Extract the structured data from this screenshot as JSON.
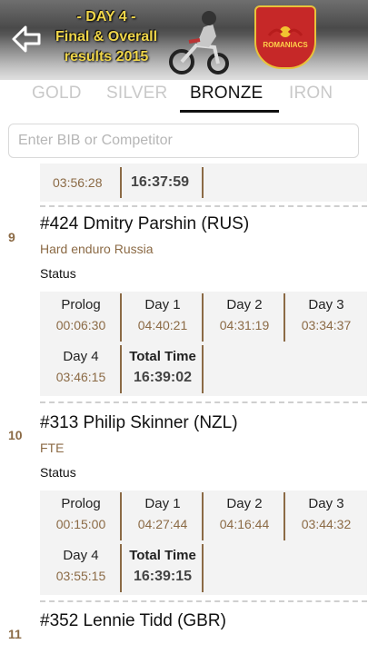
{
  "header": {
    "title_line1": "- DAY 4 -",
    "title_line2": "Final & Overall",
    "title_line3": "results 2015",
    "logo_text": "ROMANIACS",
    "back_icon": "back-arrow-icon"
  },
  "tabs": [
    {
      "label": "GOLD",
      "active": false
    },
    {
      "label": "SILVER",
      "active": false
    },
    {
      "label": "BRONZE",
      "active": true
    },
    {
      "label": "IRON",
      "active": false
    }
  ],
  "search": {
    "placeholder": "Enter BIB or Competitor"
  },
  "partial_row": {
    "day4": "03:56:28",
    "total": "16:37:59"
  },
  "labels": {
    "status": "Status",
    "prolog": "Prolog",
    "day1": "Day 1",
    "day2": "Day 2",
    "day3": "Day 3",
    "day4": "Day 4",
    "total": "Total Time"
  },
  "competitors": [
    {
      "rank": "9",
      "name": "#424 Dmitry Parshin (RUS)",
      "team": "Hard enduro Russia",
      "prolog": "00:06:30",
      "day1": "04:40:21",
      "day2": "04:31:19",
      "day3": "03:34:37",
      "day4": "03:46:15",
      "total": "16:39:02"
    },
    {
      "rank": "10",
      "name": "#313 Philip Skinner (NZL)",
      "team": "FTE",
      "prolog": "00:15:00",
      "day1": "04:27:44",
      "day2": "04:16:44",
      "day3": "03:44:32",
      "day4": "03:55:15",
      "total": "16:39:15"
    },
    {
      "rank": "11",
      "name": "#352 Lennie Tidd (GBR)"
    }
  ],
  "colors": {
    "accent": "#8b6a45",
    "title_yellow": "#f0d64a",
    "logo_red": "#c62828"
  }
}
